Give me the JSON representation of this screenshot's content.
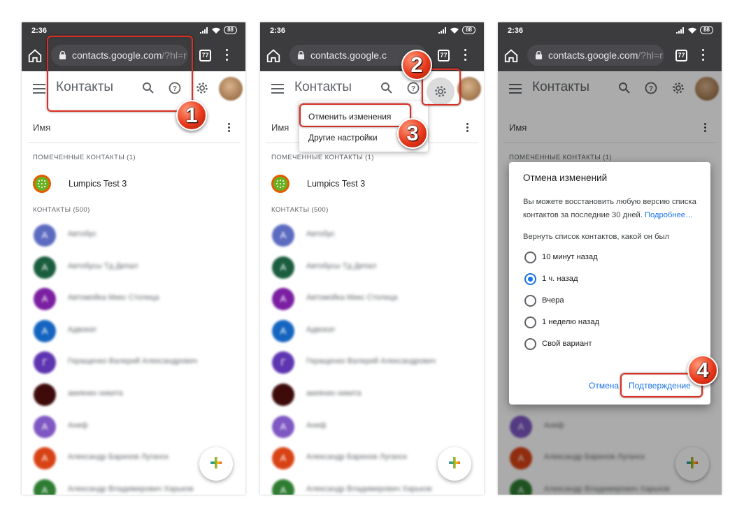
{
  "status": {
    "time": "2:36",
    "battery": "88"
  },
  "browser": {
    "url_main": "contacts.google.com",
    "url_rest_1": "/?hl=r",
    "url_main_2": "contacts.google.c",
    "url_rest_3": "/?hl=r",
    "tabs_count": "77"
  },
  "app": {
    "title": "Контакты"
  },
  "list_header": {
    "name_label": "Имя"
  },
  "sections": {
    "starred": "ПОМЕЧЕННЫЕ КОНТАКТЫ (1)",
    "contacts": "КОНТАКТЫ (500)"
  },
  "starred_contact": {
    "name": "Lumpics Test 3"
  },
  "contacts": [
    {
      "initial": "А",
      "name": "Автобус",
      "color": "#5c6bc0"
    },
    {
      "initial": "А",
      "name": "Автобусы Тд Депал",
      "color": "#1b5e3f"
    },
    {
      "initial": "А",
      "name": "Автомойка Микс Столица",
      "color": "#7b1fa2"
    },
    {
      "initial": "А",
      "name": "Адвокат",
      "color": "#1565c0"
    },
    {
      "initial": "Г",
      "name": "Геращенко Валерий Александрович",
      "color": "#5e35b1"
    },
    {
      "initial": "",
      "name": "акиянин никита",
      "color": "#3e0a0a"
    },
    {
      "initial": "А",
      "name": "Аниф",
      "color": "#7e57c2"
    },
    {
      "initial": "А",
      "name": "Александр Баринов Луганск",
      "color": "#d84315"
    },
    {
      "initial": "А",
      "name": "Александр Владимирович Харьков",
      "color": "#2e7d32"
    }
  ],
  "menu": {
    "item_undo": "Отменить изменения",
    "item_other": "Другие настройки"
  },
  "dialog": {
    "title": "Отмена изменений",
    "text": "Вы можете восстановить любую версию списка контактов за последние 30 дней.",
    "more_link": "Подробнее…",
    "question": "Вернуть список контактов, какой он был",
    "options": [
      {
        "label": "10 минут назад",
        "selected": false
      },
      {
        "label": "1 ч. назад",
        "selected": true
      },
      {
        "label": "Вчера",
        "selected": false
      },
      {
        "label": "1 неделю назад",
        "selected": false
      },
      {
        "label": "Свой вариант",
        "selected": false
      }
    ],
    "cancel": "Отмена",
    "confirm": "Подтверждение"
  },
  "steps": [
    "1",
    "2",
    "3",
    "4"
  ],
  "colors": {
    "accent": "#1a73e8",
    "callout": "#d93025",
    "toolbar": "#3c3c3e"
  }
}
